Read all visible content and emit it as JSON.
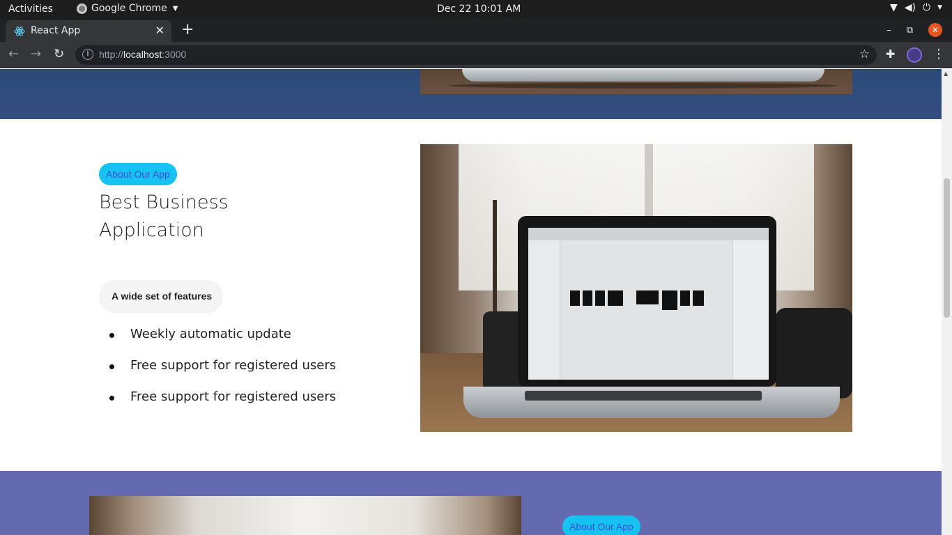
{
  "system_bar": {
    "activities": "Activities",
    "app_name": "Google Chrome",
    "datetime": "Dec 22  10:01 AM"
  },
  "browser": {
    "tab_title": "React App",
    "url_scheme": "http://",
    "url_host": "localhost",
    "url_port": ":3000"
  },
  "about_section": {
    "badge": "About Our App",
    "heading": "Best Business Application",
    "feature_label": "A wide set of features",
    "features": [
      "Weekly automatic update",
      "Free support for registered users",
      "Free support for registered users"
    ]
  },
  "next_section": {
    "badge": "About Our App"
  },
  "colors": {
    "top_section_bg": "#2f4c7c",
    "badge_bg": "#16c2f0",
    "badge_text": "#3a4fd6",
    "bottom_section_bg": "#646ab0"
  },
  "icons": {
    "tab_favicon": "react-logo-icon",
    "tab_close": "close-icon",
    "new_tab": "plus-icon",
    "back": "arrow-left-icon",
    "forward": "arrow-right-icon",
    "reload": "reload-icon",
    "site_info": "info-icon",
    "bookmark": "star-icon",
    "extensions": "puzzle-icon",
    "menu": "kebab-icon"
  }
}
